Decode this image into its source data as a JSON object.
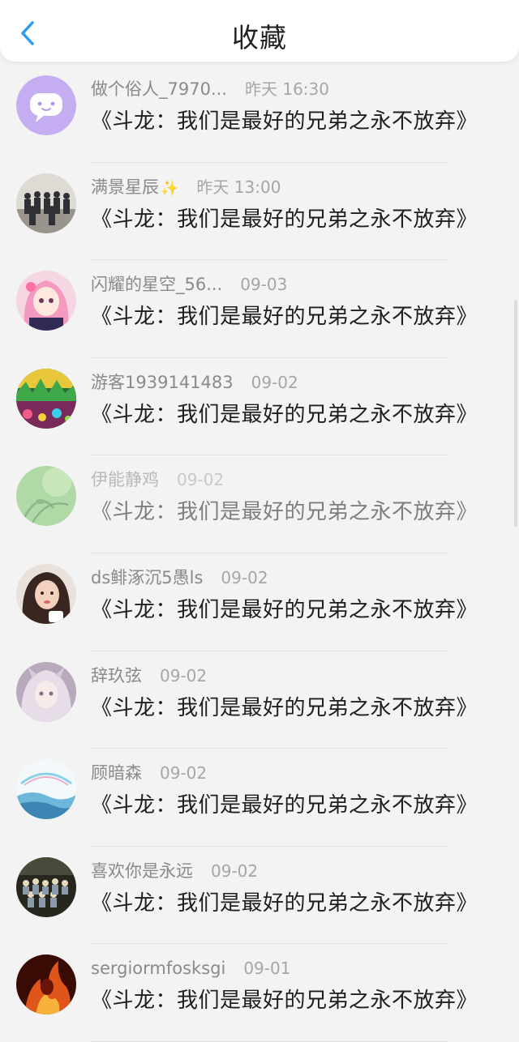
{
  "header": {
    "title": "收藏"
  },
  "items": [
    {
      "user": "做个俗人_7970...",
      "time": "昨天 16:30",
      "message": "《斗龙：我们是最好的兄弟之永不放弃》",
      "avatar": "chat-bubble-avatar",
      "colors": [
        "#c9b3f2",
        "#b597ea"
      ]
    },
    {
      "user": "满景星辰",
      "time": "昨天 13:00",
      "message": "《斗龙：我们是最好的兄弟之永不放弃》",
      "avatar": "group-photo-avatar",
      "colors": [
        "#d9d6d0",
        "#4a4a52"
      ]
    },
    {
      "user": "闪耀的星空_56...",
      "time": "09-03",
      "message": "《斗龙：我们是最好的兄弟之永不放弃》",
      "avatar": "anime-girl-avatar",
      "colors": [
        "#f4b6cf",
        "#6b3a5a"
      ]
    },
    {
      "user": "游客1939141483",
      "time": "09-02",
      "message": "《斗龙：我们是最好的兄弟之永不放弃》",
      "avatar": "colorful-art-avatar",
      "colors": [
        "#3fa84a",
        "#c44d7a"
      ]
    },
    {
      "user": "伊能静鸡",
      "time": "09-02",
      "message": "《斗龙：我们是最好的兄弟之永不放弃》",
      "avatar": "nature-avatar",
      "colors": [
        "#8fcf7a",
        "#3f8a3a"
      ]
    },
    {
      "user": "ds鲱涿沉5愚ls",
      "time": "09-02",
      "message": "《斗龙：我们是最好的兄弟之永不放弃》",
      "avatar": "portrait-avatar",
      "colors": [
        "#c7957a",
        "#3a2620"
      ]
    },
    {
      "user": "辞玖弦",
      "time": "09-02",
      "message": "《斗龙：我们是最好的兄弟之永不放弃》",
      "avatar": "anime-avatar",
      "colors": [
        "#c9bccb",
        "#8a6b8a"
      ]
    },
    {
      "user": "顾暗森",
      "time": "09-02",
      "message": "《斗龙：我们是最好的兄弟之永不放弃》",
      "avatar": "landscape-avatar",
      "colors": [
        "#e9f3f8",
        "#6db7d8"
      ]
    },
    {
      "user": "喜欢你是永远",
      "time": "09-02",
      "message": "《斗龙：我们是最好的兄弟之永不放弃》",
      "avatar": "group-photo-avatar",
      "colors": [
        "#5a5a4a",
        "#1e1e1a"
      ]
    },
    {
      "user": "sergiormfosksgi",
      "time": "09-01",
      "message": "《斗龙：我们是最好的兄弟之永不放弃》",
      "avatar": "fire-avatar",
      "colors": [
        "#f07a1a",
        "#6a1408"
      ]
    }
  ]
}
